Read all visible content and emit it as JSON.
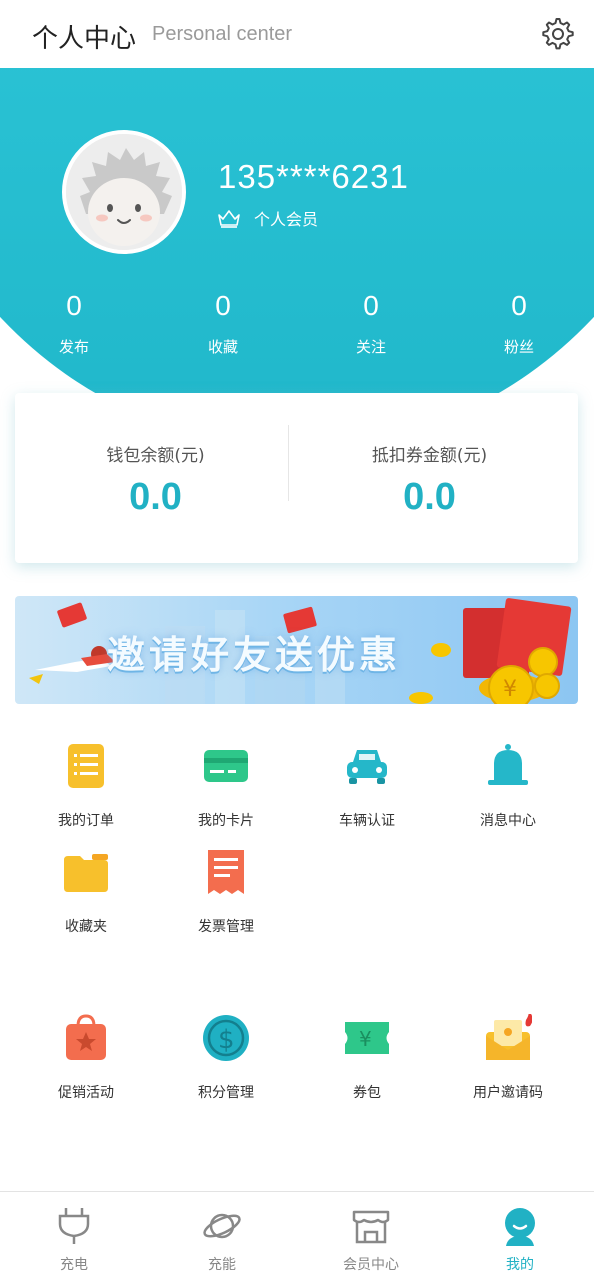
{
  "header": {
    "title": "个人中心",
    "subtitle": "Personal center",
    "settings_icon": "gear-icon"
  },
  "profile": {
    "phone": "135****6231",
    "member_label": "个人会员",
    "member_icon": "crown-icon"
  },
  "stats": [
    {
      "value": "0",
      "label": "发布"
    },
    {
      "value": "0",
      "label": "收藏"
    },
    {
      "value": "0",
      "label": "关注"
    },
    {
      "value": "0",
      "label": "粉丝"
    }
  ],
  "wallet": {
    "balance_label": "钱包余额(元)",
    "balance_value": "0.0",
    "voucher_label": "抵扣券金额(元)",
    "voucher_value": "0.0"
  },
  "banner": {
    "text": "邀请好友送优惠"
  },
  "grid_top": [
    {
      "label": "我的订单",
      "icon": "order-list-icon"
    },
    {
      "label": "我的卡片",
      "icon": "card-icon"
    },
    {
      "label": "车辆认证",
      "icon": "car-icon"
    },
    {
      "label": "消息中心",
      "icon": "bell-icon"
    },
    {
      "label": "收藏夹",
      "icon": "folder-icon"
    },
    {
      "label": "发票管理",
      "icon": "invoice-icon"
    }
  ],
  "grid_bottom": [
    {
      "label": "促销活动",
      "icon": "shopping-bag-icon"
    },
    {
      "label": "积分管理",
      "icon": "dollar-coin-icon"
    },
    {
      "label": "券包",
      "icon": "coupon-icon"
    },
    {
      "label": "用户邀请码",
      "icon": "invite-envelope-icon"
    }
  ],
  "nav": [
    {
      "label": "充电",
      "icon": "plug-icon"
    },
    {
      "label": "充能",
      "icon": "planet-icon"
    },
    {
      "label": "会员中心",
      "icon": "store-icon"
    },
    {
      "label": "我的",
      "icon": "user-icon"
    }
  ],
  "colors": {
    "accent": "#21b1c4",
    "hero_top": "#35cfe0",
    "hero_bottom": "#20b7ca"
  }
}
